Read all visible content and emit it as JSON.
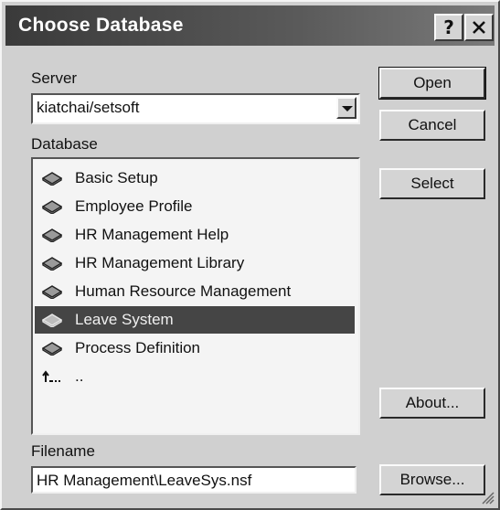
{
  "window": {
    "title": "Choose Database",
    "help_label": "?",
    "close_label": "✕"
  },
  "server": {
    "label": "Server",
    "value": "kiatchai/setsoft"
  },
  "database": {
    "label": "Database",
    "items": [
      {
        "label": "Basic Setup",
        "icon": "database-book-icon",
        "selected": false
      },
      {
        "label": "Employee Profile",
        "icon": "database-book-icon",
        "selected": false
      },
      {
        "label": "HR Management Help",
        "icon": "database-book-icon",
        "selected": false
      },
      {
        "label": "HR Management Library",
        "icon": "database-book-icon",
        "selected": false
      },
      {
        "label": "Human Resource Management",
        "icon": "database-book-icon",
        "selected": false
      },
      {
        "label": "Leave System",
        "icon": "database-book-icon",
        "selected": true
      },
      {
        "label": "Process Definition",
        "icon": "database-book-icon",
        "selected": false
      },
      {
        "label": "..",
        "icon": "parent-folder-icon",
        "selected": false
      }
    ]
  },
  "buttons": {
    "open": "Open",
    "cancel": "Cancel",
    "select": "Select",
    "about": "About...",
    "browse": "Browse..."
  },
  "filename": {
    "label": "Filename",
    "value": "HR Management\\LeaveSys.nsf"
  }
}
